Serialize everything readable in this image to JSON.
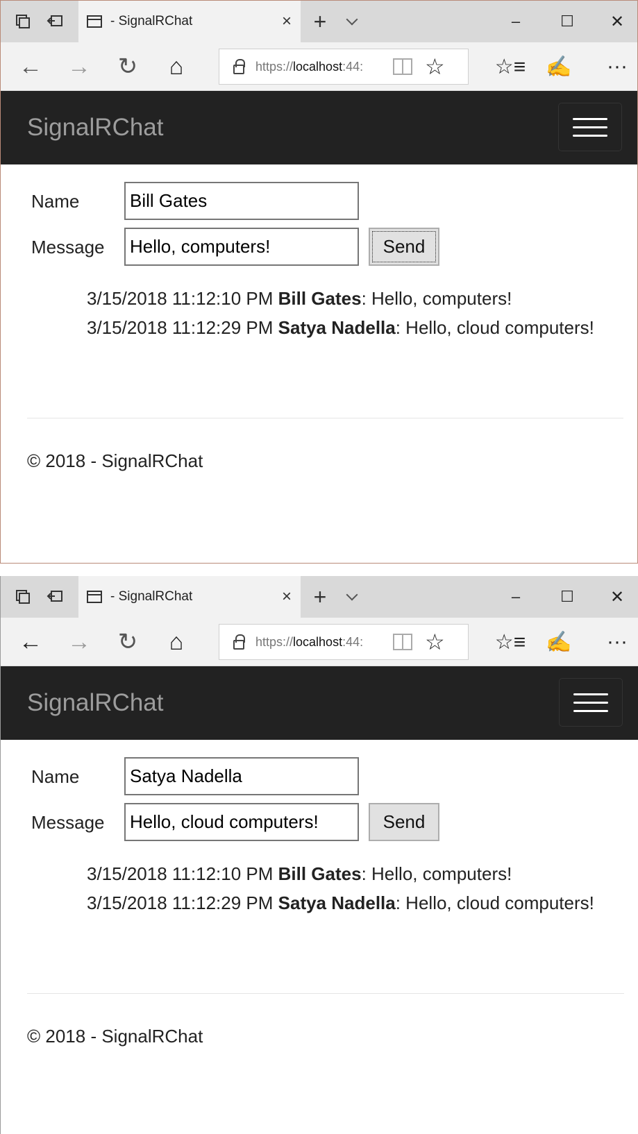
{
  "windows": [
    {
      "tab_title": "- SignalRChat",
      "url_prefix": "https://",
      "url_host": "localhost",
      "url_port": ":44:",
      "brand": "SignalRChat",
      "name_label": "Name",
      "name_value": "Bill Gates",
      "message_label": "Message",
      "message_value": "Hello, computers!",
      "send_label": "Send",
      "messages": [
        {
          "time": "3/15/2018 11:12:10 PM",
          "user": "Bill Gates",
          "text": ": Hello, computers!"
        },
        {
          "time": "3/15/2018 11:12:29 PM",
          "user": "Satya Nadella",
          "text": ": Hello, cloud computers!"
        }
      ],
      "footer": "© 2018 - SignalRChat"
    },
    {
      "tab_title": "- SignalRChat",
      "url_prefix": "https://",
      "url_host": "localhost",
      "url_port": ":44:",
      "brand": "SignalRChat",
      "name_label": "Name",
      "name_value": "Satya Nadella",
      "message_label": "Message",
      "message_value": "Hello, cloud computers!",
      "send_label": "Send",
      "messages": [
        {
          "time": "3/15/2018 11:12:10 PM",
          "user": "Bill Gates",
          "text": ": Hello, computers!"
        },
        {
          "time": "3/15/2018 11:12:29 PM",
          "user": "Satya Nadella",
          "text": ": Hello, cloud computers!"
        }
      ],
      "footer": "© 2018 - SignalRChat"
    }
  ],
  "icons": {
    "tab_preview": "tab-preview-icon",
    "set_aside": "set-aside-tabs-icon",
    "close": "×",
    "new_tab": "+",
    "minimize": "–",
    "maximize": "☐",
    "window_close": "✕",
    "back": "←",
    "forward": "→",
    "refresh": "↻",
    "home": "⌂",
    "favorite": "☆",
    "favorites_hub": "☆≡",
    "notes": "✍",
    "more": "···"
  },
  "colors": {
    "header_bg": "#222222",
    "brand_text": "#9d9d9d",
    "tabbar_bg": "#d9d9d9"
  }
}
